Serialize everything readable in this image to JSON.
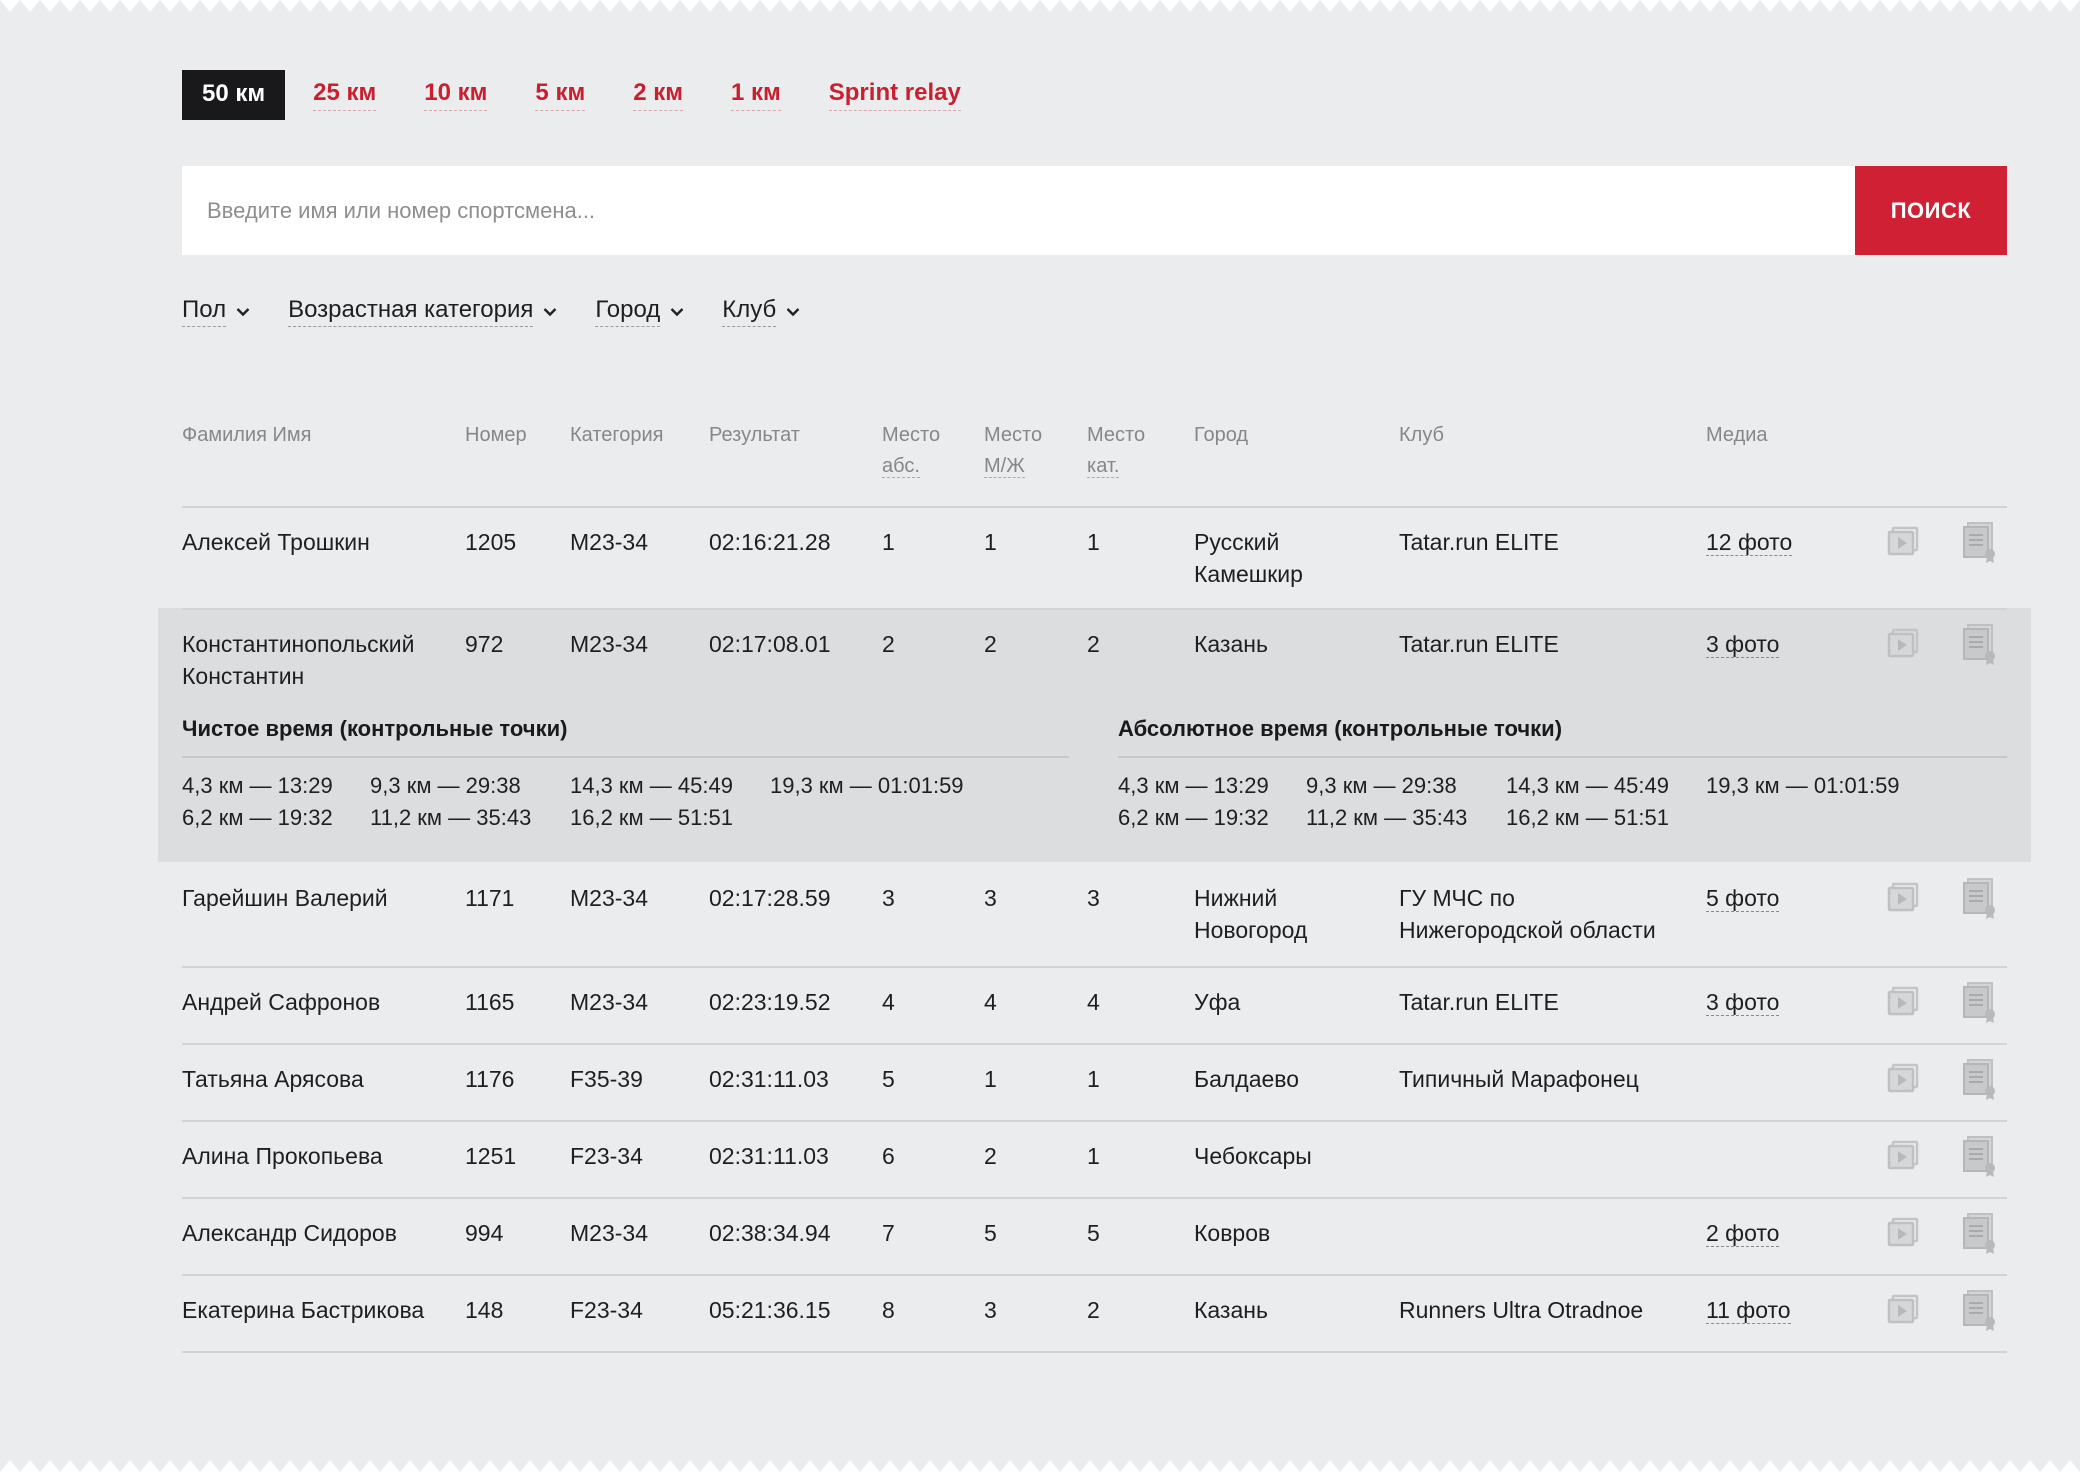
{
  "tabs": [
    {
      "label": "50 км",
      "active": true
    },
    {
      "label": "25 км",
      "active": false
    },
    {
      "label": "10 км",
      "active": false
    },
    {
      "label": "5 км",
      "active": false
    },
    {
      "label": "2 км",
      "active": false
    },
    {
      "label": "1 км",
      "active": false
    },
    {
      "label": "Sprint relay",
      "active": false
    }
  ],
  "search": {
    "placeholder": "Введите имя или номер спортсмена...",
    "value": "",
    "button_label": "ПОИСК"
  },
  "filters": [
    {
      "label": "Пол"
    },
    {
      "label": "Возрастная категория"
    },
    {
      "label": "Город"
    },
    {
      "label": "Клуб"
    }
  ],
  "columns": {
    "name": "Фамилия Имя",
    "number": "Номер",
    "category": "Категория",
    "result": "Результат",
    "place_abs": [
      "Место",
      "абс."
    ],
    "place_mf": [
      "Место",
      "М/Ж"
    ],
    "place_cat": [
      "Место",
      "кат."
    ],
    "city": "Город",
    "club": "Клуб",
    "media": "Медиа"
  },
  "rows": [
    {
      "name": [
        "Алексей Трошкин"
      ],
      "number": "1205",
      "category": "M23-34",
      "result": "02:16:21.28",
      "place_abs": "1",
      "place_mf": "1",
      "place_cat": "1",
      "city": [
        "Русский",
        "Камешкир"
      ],
      "club": [
        "Tatar.run ELITE"
      ],
      "media": "12 фото"
    },
    {
      "name": [
        "Константинопольский",
        "Константин"
      ],
      "number": "972",
      "category": "M23-34",
      "result": "02:17:08.01",
      "place_abs": "2",
      "place_mf": "2",
      "place_cat": "2",
      "city": [
        "Казань"
      ],
      "club": [
        "Tatar.run ELITE"
      ],
      "media": "3 фото"
    },
    {
      "name": [
        "Гарейшин Валерий"
      ],
      "number": "1171",
      "category": "M23-34",
      "result": "02:17:28.59",
      "place_abs": "3",
      "place_mf": "3",
      "place_cat": "3",
      "city": [
        "Нижний",
        "Новогород"
      ],
      "club": [
        "ГУ МЧС по",
        "Нижегородской области"
      ],
      "media": "5 фото"
    },
    {
      "name": [
        "Андрей Сафронов"
      ],
      "number": "1165",
      "category": "M23-34",
      "result": "02:23:19.52",
      "place_abs": "4",
      "place_mf": "4",
      "place_cat": "4",
      "city": [
        "Уфа"
      ],
      "club": [
        "Tatar.run ELITE"
      ],
      "media": "3 фото"
    },
    {
      "name": [
        "Татьяна Арясова"
      ],
      "number": "1176",
      "category": "F35-39",
      "result": "02:31:11.03",
      "place_abs": "5",
      "place_mf": "1",
      "place_cat": "1",
      "city": [
        "Балдаево"
      ],
      "club": [
        "Типичный Марафонец"
      ],
      "media": ""
    },
    {
      "name": [
        "Алина Прокопьева"
      ],
      "number": "1251",
      "category": "F23-34",
      "result": "02:31:11.03",
      "place_abs": "6",
      "place_mf": "2",
      "place_cat": "1",
      "city": [
        "Чебоксары"
      ],
      "club": [
        ""
      ],
      "media": ""
    },
    {
      "name": [
        "Александр Сидоров"
      ],
      "number": "994",
      "category": "M23-34",
      "result": "02:38:34.94",
      "place_abs": "7",
      "place_mf": "5",
      "place_cat": "5",
      "city": [
        "Ковров"
      ],
      "club": [
        ""
      ],
      "media": "2 фото"
    },
    {
      "name": [
        "Екатерина Бастрикова"
      ],
      "number": "148",
      "category": "F23-34",
      "result": "05:21:36.15",
      "place_abs": "8",
      "place_mf": "3",
      "place_cat": "2",
      "city": [
        "Казань"
      ],
      "club": [
        "Runners Ultra Otradnoe"
      ],
      "media": "11 фото"
    }
  ],
  "expanded": {
    "net_title": "Чистое время (контрольные точки)",
    "abs_title": "Абсолютное время (контрольные точки)",
    "net": [
      [
        "4,3 км — 13:29",
        "6,2 км — 19:32"
      ],
      [
        "9,3 км — 29:38",
        "11,2 км — 35:43"
      ],
      [
        "14,3 км — 45:49",
        "16,2 км — 51:51"
      ],
      [
        "19,3 км — 01:01:59",
        ""
      ]
    ],
    "abs": [
      [
        "4,3 км — 13:29",
        "6,2 км — 19:32"
      ],
      [
        "9,3 км — 29:38",
        "11,2 км — 35:43"
      ],
      [
        "14,3 км — 45:49",
        "16,2 км — 51:51"
      ],
      [
        "19,3 км — 01:01:59",
        ""
      ]
    ]
  },
  "icons": {
    "video": "video-play-icon",
    "certificate": "certificate-icon",
    "chevron": "chevron-down-icon"
  },
  "colors": {
    "accent": "#cf2034",
    "background": "#ebecee",
    "active_tab": "#19191b",
    "expanded_bg": "#dcdddf"
  }
}
